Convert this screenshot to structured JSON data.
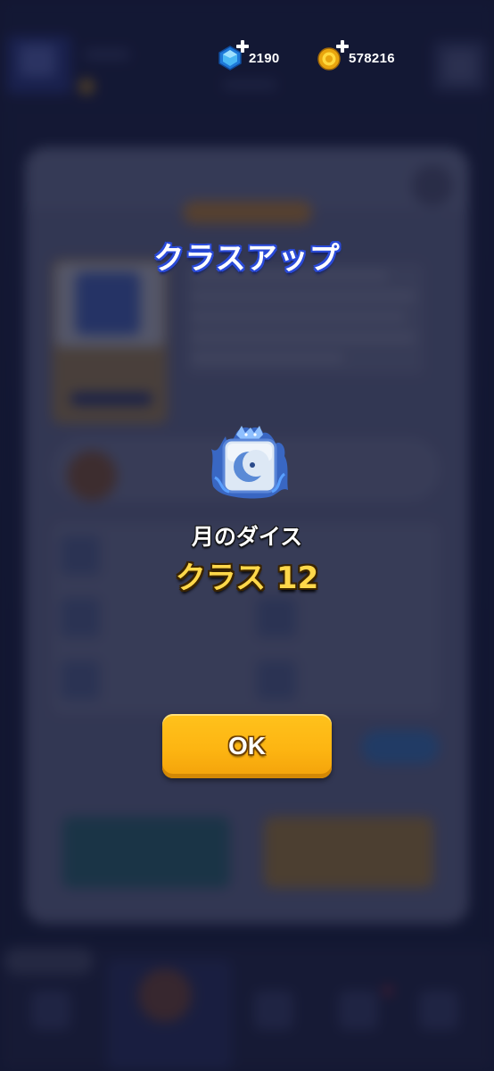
{
  "header": {
    "gems": {
      "value": "2190",
      "icon": "blue-gem-icon"
    },
    "coins": {
      "value": "578216",
      "icon": "gold-coin-icon"
    }
  },
  "modal": {
    "title": "クラスアップ",
    "item_name": "月のダイス",
    "class_level": "クラス 12",
    "item_icon": "moon-dice-icon",
    "ok_label": "OK"
  },
  "colors": {
    "title_outline": "#2b4bd8",
    "class_level": "#ffd84a",
    "ok_button": "#fdb512",
    "overlay": "#0e1228"
  }
}
